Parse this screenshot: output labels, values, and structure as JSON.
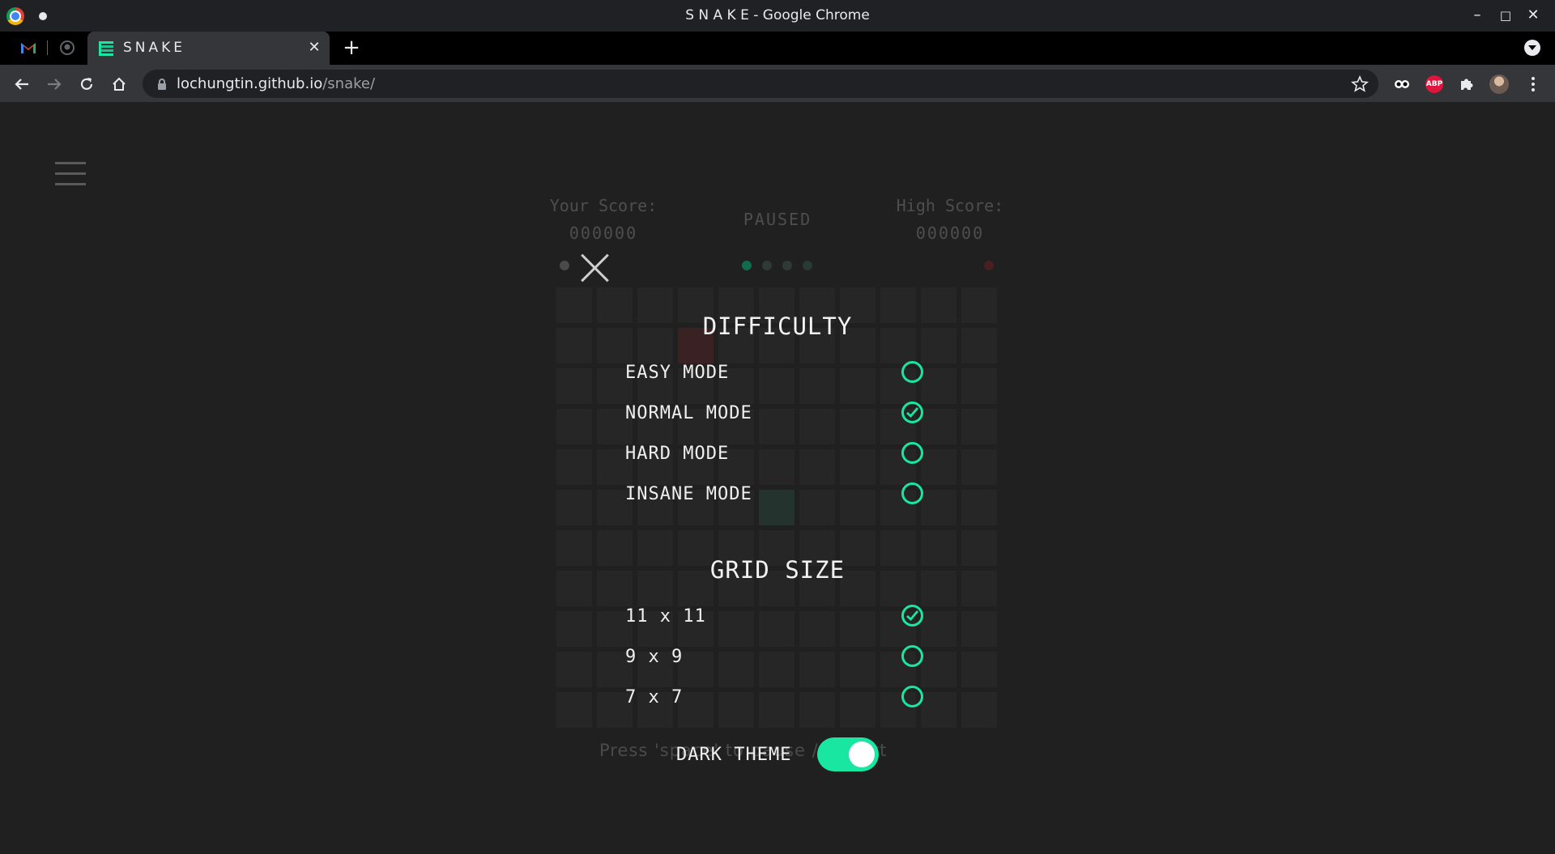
{
  "window": {
    "title": "S N A K E - Google Chrome",
    "minimize": "–",
    "maximize": "□",
    "close": "✕"
  },
  "tabs": {
    "active_title": "SNAKE",
    "close_glyph": "✕",
    "new_tab_glyph": "+"
  },
  "address_bar": {
    "domain": "lochungtin.github.io",
    "path": "/snake/"
  },
  "game": {
    "your_score_label": "Your Score:",
    "your_score_value": "000000",
    "status": "PAUSED",
    "high_score_label": "High Score:",
    "high_score_value": "000000",
    "hint_text": "Press 'space' to pause / restart",
    "accent_color": "#19e6a1"
  },
  "settings": {
    "difficulty_title": "DIFFICULTY",
    "difficulty_options": [
      {
        "label": "EASY MODE",
        "selected": false
      },
      {
        "label": "NORMAL MODE",
        "selected": true
      },
      {
        "label": "HARD MODE",
        "selected": false
      },
      {
        "label": "INSANE MODE",
        "selected": false
      }
    ],
    "grid_title": "GRID SIZE",
    "grid_options": [
      {
        "label": "11 x 11",
        "selected": true
      },
      {
        "label": "9 x 9",
        "selected": false
      },
      {
        "label": "7 x 7",
        "selected": false
      }
    ],
    "dark_theme_label": "DARK THEME",
    "dark_theme_on": true
  }
}
